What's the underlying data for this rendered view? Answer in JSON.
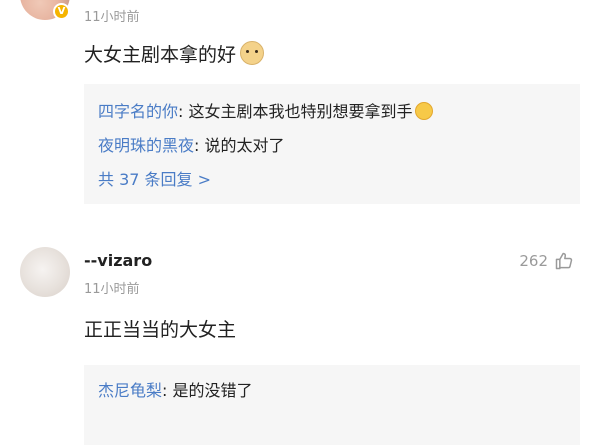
{
  "comments": [
    {
      "username": "",
      "time": "11小时前",
      "text": "大女主剧本拿的好",
      "replies": [
        {
          "name": "四字名的你",
          "sep": ":",
          "text": " 这女主剧本我也特别想要拿到手"
        },
        {
          "name": "夜明珠的黑夜",
          "sep": ":",
          "text": " 说的太对了"
        }
      ],
      "more": "共 37 条回复 >"
    },
    {
      "username": "--vizaro",
      "time": "11小时前",
      "likes": "262",
      "text": "正正当当的大女主",
      "replies": [
        {
          "name": "杰尼龟梨",
          "sep": ":",
          "text": " 是的没错了"
        }
      ]
    }
  ],
  "icons": {
    "verified_badge": "verified-badge-icon",
    "like": "thumbs-up-icon",
    "emoji_doge": "doge-emoji-icon",
    "emoji_smirk": "smirk-emoji-icon"
  },
  "colors": {
    "link_blue": "#4a7cc6",
    "badge_yellow": "#f5b400",
    "muted_gray": "#9a9a9a",
    "reply_bg": "#f6f6f6"
  }
}
